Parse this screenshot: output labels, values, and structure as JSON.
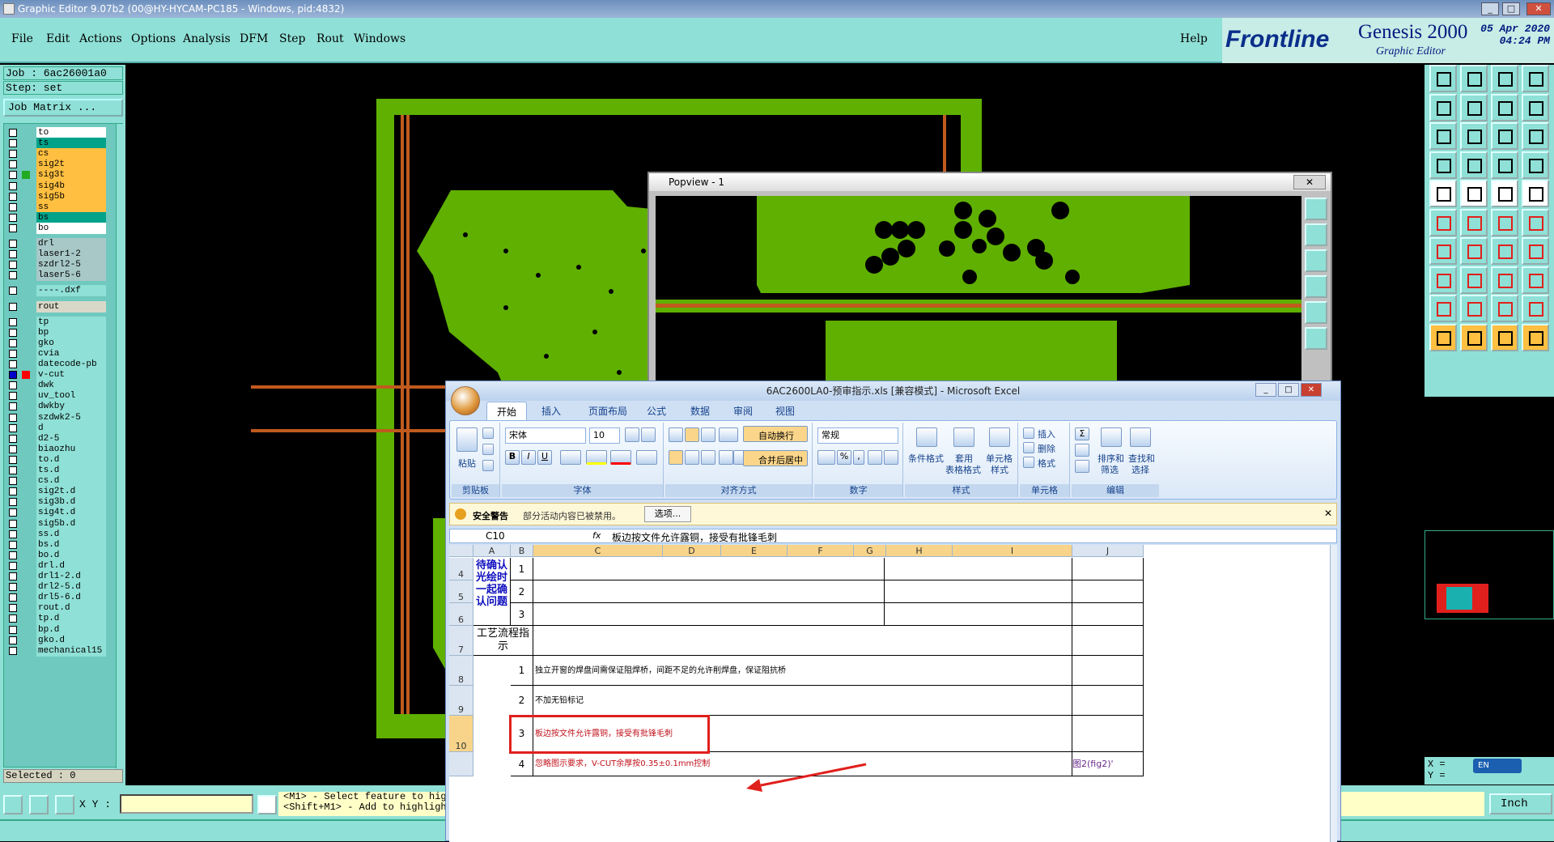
{
  "window": {
    "title": "Graphic Editor 9.07b2 (00@HY-HYCAM-PC185 - Windows, pid:4832)",
    "btn_min": "_",
    "btn_max": "□",
    "btn_close": "✕"
  },
  "menu": {
    "items": [
      "File",
      "Edit",
      "Actions",
      "Options",
      "Analysis",
      "DFM",
      "Step",
      "Rout",
      "Windows"
    ],
    "help": "Help"
  },
  "brand": {
    "logo": "Frontline",
    "product": "Genesis 2000",
    "sub": "Graphic Editor",
    "date": "05 Apr 2020",
    "time": "04:24 PM"
  },
  "job": {
    "job_line": "Job : 6ac26001a0",
    "step_line": "Step: set",
    "matrix_button": "Job Matrix ...",
    "selected": "Selected : 0"
  },
  "layers": [
    {
      "name": "to",
      "color": "#ffffff"
    },
    {
      "name": "ts",
      "color": "#00a28a"
    },
    {
      "name": "cs",
      "color": "#ffbf40"
    },
    {
      "name": "sig2t",
      "color": "#ffbf40"
    },
    {
      "name": "sig3t",
      "color": "#ffbf40",
      "mark": "#22aa22"
    },
    {
      "name": "sig4b",
      "color": "#ffbf40"
    },
    {
      "name": "sig5b",
      "color": "#ffbf40"
    },
    {
      "name": "ss",
      "color": "#ffbf40"
    },
    {
      "name": "bs",
      "color": "#00a28a"
    },
    {
      "name": "bo",
      "color": "#ffffff"
    },
    {
      "name": "drl",
      "color": "#a8c8c8"
    },
    {
      "name": "laser1-2",
      "color": "#a8c8c8"
    },
    {
      "name": "szdrl2-5",
      "color": "#a8c8c8"
    },
    {
      "name": "laser5-6",
      "color": "#a8c8c8"
    },
    {
      "name": "----.dxf",
      "color": "#8fe0d6"
    },
    {
      "name": "rout",
      "color": "#d8d8c8"
    },
    {
      "name": "tp",
      "color": "#8fe0d6"
    },
    {
      "name": "bp",
      "color": "#8fe0d6"
    },
    {
      "name": "gko",
      "color": "#8fe0d6"
    },
    {
      "name": "cvia",
      "color": "#8fe0d6"
    },
    {
      "name": "datecode-pb",
      "color": "#8fe0d6"
    },
    {
      "name": "v-cut",
      "color": "#8fe0d6",
      "mark": "#ff0000",
      "cb": "#0000cc"
    },
    {
      "name": "dwk",
      "color": "#8fe0d6"
    },
    {
      "name": "uv_tool",
      "color": "#8fe0d6"
    },
    {
      "name": "dwkby",
      "color": "#8fe0d6"
    },
    {
      "name": "szdwk2-5",
      "color": "#8fe0d6"
    },
    {
      "name": "d",
      "color": "#8fe0d6"
    },
    {
      "name": "d2-5",
      "color": "#8fe0d6"
    },
    {
      "name": "biaozhu",
      "color": "#8fe0d6"
    },
    {
      "name": "to.d",
      "color": "#8fe0d6"
    },
    {
      "name": "ts.d",
      "color": "#8fe0d6"
    },
    {
      "name": "cs.d",
      "color": "#8fe0d6"
    },
    {
      "name": "sig2t.d",
      "color": "#8fe0d6"
    },
    {
      "name": "sig3b.d",
      "color": "#8fe0d6"
    },
    {
      "name": "sig4t.d",
      "color": "#8fe0d6"
    },
    {
      "name": "sig5b.d",
      "color": "#8fe0d6"
    },
    {
      "name": "ss.d",
      "color": "#8fe0d6"
    },
    {
      "name": "bs.d",
      "color": "#8fe0d6"
    },
    {
      "name": "bo.d",
      "color": "#8fe0d6"
    },
    {
      "name": "drl.d",
      "color": "#8fe0d6"
    },
    {
      "name": "drl1-2.d",
      "color": "#8fe0d6"
    },
    {
      "name": "drl2-5.d",
      "color": "#8fe0d6"
    },
    {
      "name": "drl5-6.d",
      "color": "#8fe0d6"
    },
    {
      "name": "rout.d",
      "color": "#8fe0d6"
    },
    {
      "name": "tp.d",
      "color": "#8fe0d6"
    },
    {
      "name": "bp.d",
      "color": "#8fe0d6"
    },
    {
      "name": "gko.d",
      "color": "#8fe0d6"
    },
    {
      "name": "mechanical15",
      "color": "#8fe0d6"
    }
  ],
  "bottom": {
    "xy_label": "X Y :",
    "msg1": "<M1> - Select feature to hig",
    "msg2": "<Shift+M1> - Add to highligh",
    "units": "Inch",
    "coord_x": "X =",
    "coord_y": "Y =",
    "ime": "EN"
  },
  "popview": {
    "title": "Popview - 1",
    "close": "✕"
  },
  "excel": {
    "title": "6AC2600LA0-预审指示.xls [兼容模式] - Microsoft Excel",
    "tabs": [
      "开始",
      "插入",
      "页面布局",
      "公式",
      "数据",
      "审阅",
      "视图"
    ],
    "ribbon": {
      "paste": "粘贴",
      "clipboard": "剪贴板",
      "font_name": "宋体",
      "font_size": "10",
      "font_group": "字体",
      "wrap": "自动换行",
      "merge": "合并后居中",
      "align_group": "对齐方式",
      "number_format": "常规",
      "number_group": "数字",
      "cond_fmt": "条件格式",
      "table_fmt1": "套用",
      "table_fmt2": "表格格式",
      "cell_style1": "单元格",
      "cell_style2": "样式",
      "styles_group": "样式",
      "insert": "插入",
      "delete": "删除",
      "format": "格式",
      "cells_group": "单元格",
      "sort1": "排序和",
      "sort2": "筛选",
      "find1": "查找和",
      "find2": "选择",
      "edit_group": "编辑"
    },
    "security": {
      "label": "安全警告",
      "text": "部分活动内容已被禁用。",
      "button": "选项..."
    },
    "namebox": "C10",
    "fx": "fx",
    "formula": "板边按文件允许露铜，接受有批锋毛刺",
    "columns": [
      "A",
      "B",
      "C",
      "D",
      "E",
      "F",
      "G",
      "H",
      "I",
      "J"
    ],
    "rows": [
      {
        "num": "4",
        "b": "1"
      },
      {
        "num": "5",
        "b": "2"
      },
      {
        "num": "6",
        "b": "3"
      },
      {
        "num": "7"
      },
      {
        "num": "8",
        "b": "1",
        "c": "独立开窗的焊盘间需保证阻焊桥，间距不足的允许削焊盘，保证阻抗桥"
      },
      {
        "num": "9",
        "b": "2",
        "c": "不加无铅标记"
      },
      {
        "num": "10",
        "b": "3",
        "c": "板边按文件允许露铜，接受有批锋毛刺"
      },
      {
        "num": "",
        "b": "4",
        "c": "忽略图示要求，V-CUT余厚按0.35±0.1mm控制",
        "j": "图2(fig2)'"
      }
    ],
    "a_block": "待确认光绘时一起确认问题",
    "a_row7": "工艺流程指示"
  },
  "colors": {
    "panel": "#8fe0d6",
    "copper": "#5fb000",
    "route": "#c05a1e",
    "highlight": "#e0201c"
  }
}
